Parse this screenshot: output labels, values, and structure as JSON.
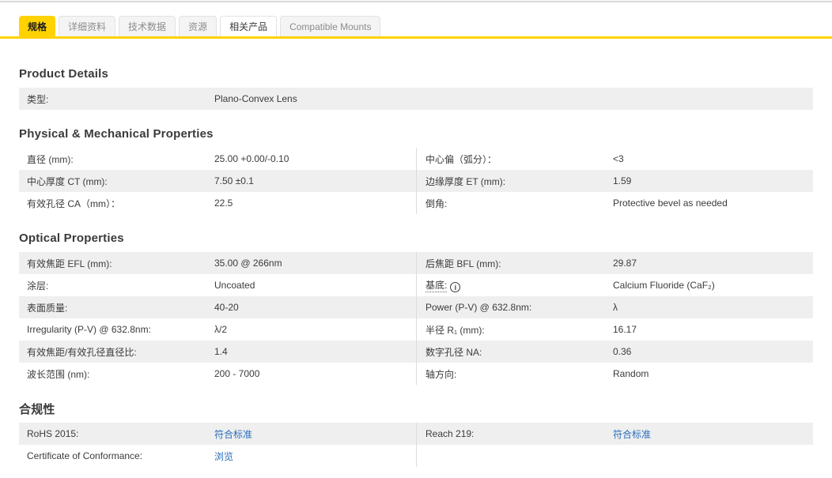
{
  "tabs": [
    {
      "label": "规格",
      "state": "active"
    },
    {
      "label": "详细资料",
      "state": "inactive"
    },
    {
      "label": "技术数据",
      "state": "inactive"
    },
    {
      "label": "资源",
      "state": "inactive"
    },
    {
      "label": "相关产品",
      "state": "highlight"
    },
    {
      "label": "Compatible Mounts",
      "state": "inactive"
    }
  ],
  "colors": {
    "accent_yellow": "#ffd200",
    "row_gray": "#efefef",
    "link_blue": "#2a6ebb",
    "text": "#3b3b3b"
  },
  "sections": {
    "product_details": {
      "title": "Product Details",
      "rows": [
        {
          "left": {
            "label": "类型:",
            "value": "Plano-Convex Lens"
          }
        }
      ]
    },
    "physical": {
      "title": "Physical & Mechanical Properties",
      "rows": [
        {
          "left": {
            "label": "直径 (mm):",
            "value": "25.00 +0.00/-0.10"
          },
          "right": {
            "label": "中心偏（弧分）：",
            "value": "<3"
          }
        },
        {
          "left": {
            "label": "中心厚度 CT (mm):",
            "value": "7.50 ±0.1"
          },
          "right": {
            "label": "边缘厚度 ET (mm):",
            "value": "1.59"
          }
        },
        {
          "left": {
            "label": "有效孔径 CA（mm）：",
            "value": "22.5"
          },
          "right": {
            "label": "倒角:",
            "value": "Protective bevel as needed"
          }
        }
      ]
    },
    "optical": {
      "title": "Optical Properties",
      "rows": [
        {
          "left": {
            "label": "有效焦距 EFL (mm):",
            "value": "35.00 @ 266nm"
          },
          "right": {
            "label": "后焦距 BFL (mm):",
            "value": "29.87"
          }
        },
        {
          "left": {
            "label": "涂层:",
            "value": "Uncoated"
          },
          "right": {
            "label": "基底:",
            "value": "Calcium Fluoride (CaF₂)",
            "info_icon": "i"
          }
        },
        {
          "left": {
            "label": "表面质量:",
            "value": "40-20"
          },
          "right": {
            "label": "Power (P-V) @ 632.8nm:",
            "value": "λ"
          }
        },
        {
          "left": {
            "label": "Irregularity (P-V) @ 632.8nm:",
            "value": "λ/2"
          },
          "right": {
            "label": "半径 R₁ (mm):",
            "value": "16.17"
          }
        },
        {
          "left": {
            "label": "有效焦距/有效孔径直径比:",
            "value": "1.4"
          },
          "right": {
            "label": "数字孔径 NA:",
            "value": "0.36"
          }
        },
        {
          "left": {
            "label": "波长范围 (nm):",
            "value": "200 - 7000"
          },
          "right": {
            "label": "轴方向:",
            "value": "Random"
          }
        }
      ]
    },
    "compliance": {
      "title": "合规性",
      "rows": [
        {
          "left": {
            "label": "RoHS 2015:",
            "value": "符合标准",
            "link": true
          },
          "right": {
            "label": "Reach 219:",
            "value": "符合标准",
            "link": true
          }
        },
        {
          "left": {
            "label": "Certificate of Conformance:",
            "value": "浏览",
            "link": true
          }
        }
      ]
    }
  }
}
